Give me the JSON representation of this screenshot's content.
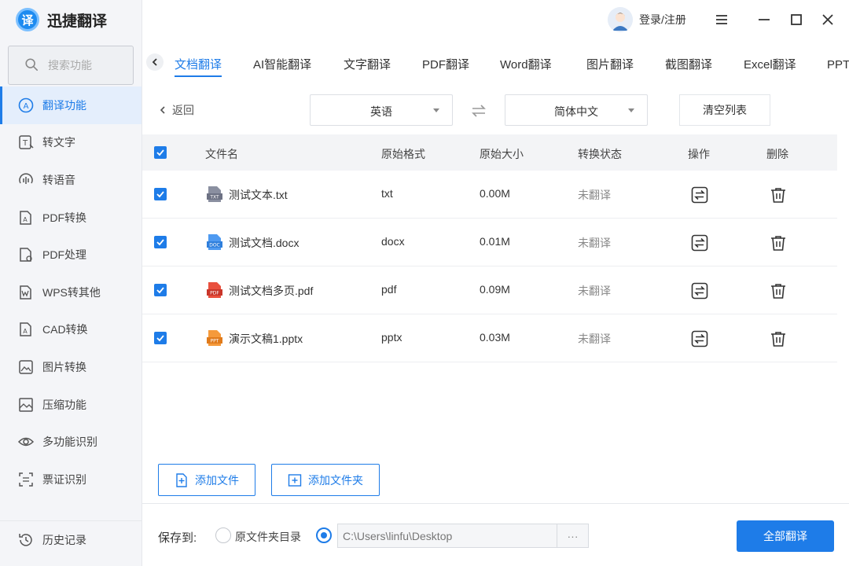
{
  "app": {
    "name": "迅捷翻译",
    "logo_char": "译"
  },
  "sidebar": {
    "search_placeholder": "搜索功能",
    "items": [
      {
        "label": "翻译功能",
        "icon": "translate-icon",
        "active": true
      },
      {
        "label": "转文字",
        "icon": "to-text-icon"
      },
      {
        "label": "转语音",
        "icon": "to-voice-icon"
      },
      {
        "label": "PDF转换",
        "icon": "pdf-convert-icon"
      },
      {
        "label": "PDF处理",
        "icon": "pdf-process-icon"
      },
      {
        "label": "WPS转其他",
        "icon": "wps-convert-icon"
      },
      {
        "label": "CAD转换",
        "icon": "cad-convert-icon"
      },
      {
        "label": "图片转换",
        "icon": "image-convert-icon"
      },
      {
        "label": "压缩功能",
        "icon": "compress-icon"
      },
      {
        "label": "多功能识别",
        "icon": "eye-icon"
      },
      {
        "label": "票证识别",
        "icon": "ticket-icon"
      }
    ],
    "history_label": "历史记录"
  },
  "header": {
    "login_label": "登录/注册"
  },
  "tabs": [
    "文档翻译",
    "AI智能翻译",
    "文字翻译",
    "PDF翻译",
    "Word翻译",
    "图片翻译",
    "截图翻译",
    "Excel翻译",
    "PPT翻"
  ],
  "toolbar": {
    "back_label": "返回",
    "source_lang": "英语",
    "target_lang": "简体中文",
    "clear_label": "清空列表"
  },
  "table": {
    "headers": {
      "name": "文件名",
      "format": "原始格式",
      "size": "原始大小",
      "status": "转换状态",
      "action": "操作",
      "delete": "删除"
    },
    "rows": [
      {
        "name": "测试文本.txt",
        "format": "txt",
        "size": "0.00M",
        "status": "未翻译",
        "icon": "txt-file-icon"
      },
      {
        "name": "测试文档.docx",
        "format": "docx",
        "size": "0.01M",
        "status": "未翻译",
        "icon": "docx-file-icon"
      },
      {
        "name": "测试文档多页.pdf",
        "format": "pdf",
        "size": "0.09M",
        "status": "未翻译",
        "icon": "pdf-file-icon"
      },
      {
        "name": "演示文稿1.pptx",
        "format": "pptx",
        "size": "0.03M",
        "status": "未翻译",
        "icon": "pptx-file-icon"
      }
    ],
    "file_icon_labels": {
      "txt": "TXT",
      "docx": "DOC",
      "pdf": "PDF",
      "pptx": "PPT"
    }
  },
  "actions": {
    "add_file": "添加文件",
    "add_folder": "添加文件夹"
  },
  "footer": {
    "save_to_label": "保存到:",
    "option_original": "原文件夹目录",
    "path_value": "C:\\Users\\linfu\\Desktop",
    "more_label": "···",
    "translate_all": "全部翻译"
  },
  "colors": {
    "accent": "#1e7ce8",
    "sidebar_bg": "#f4f5f8",
    "header_row_bg": "#f3f4f6"
  }
}
